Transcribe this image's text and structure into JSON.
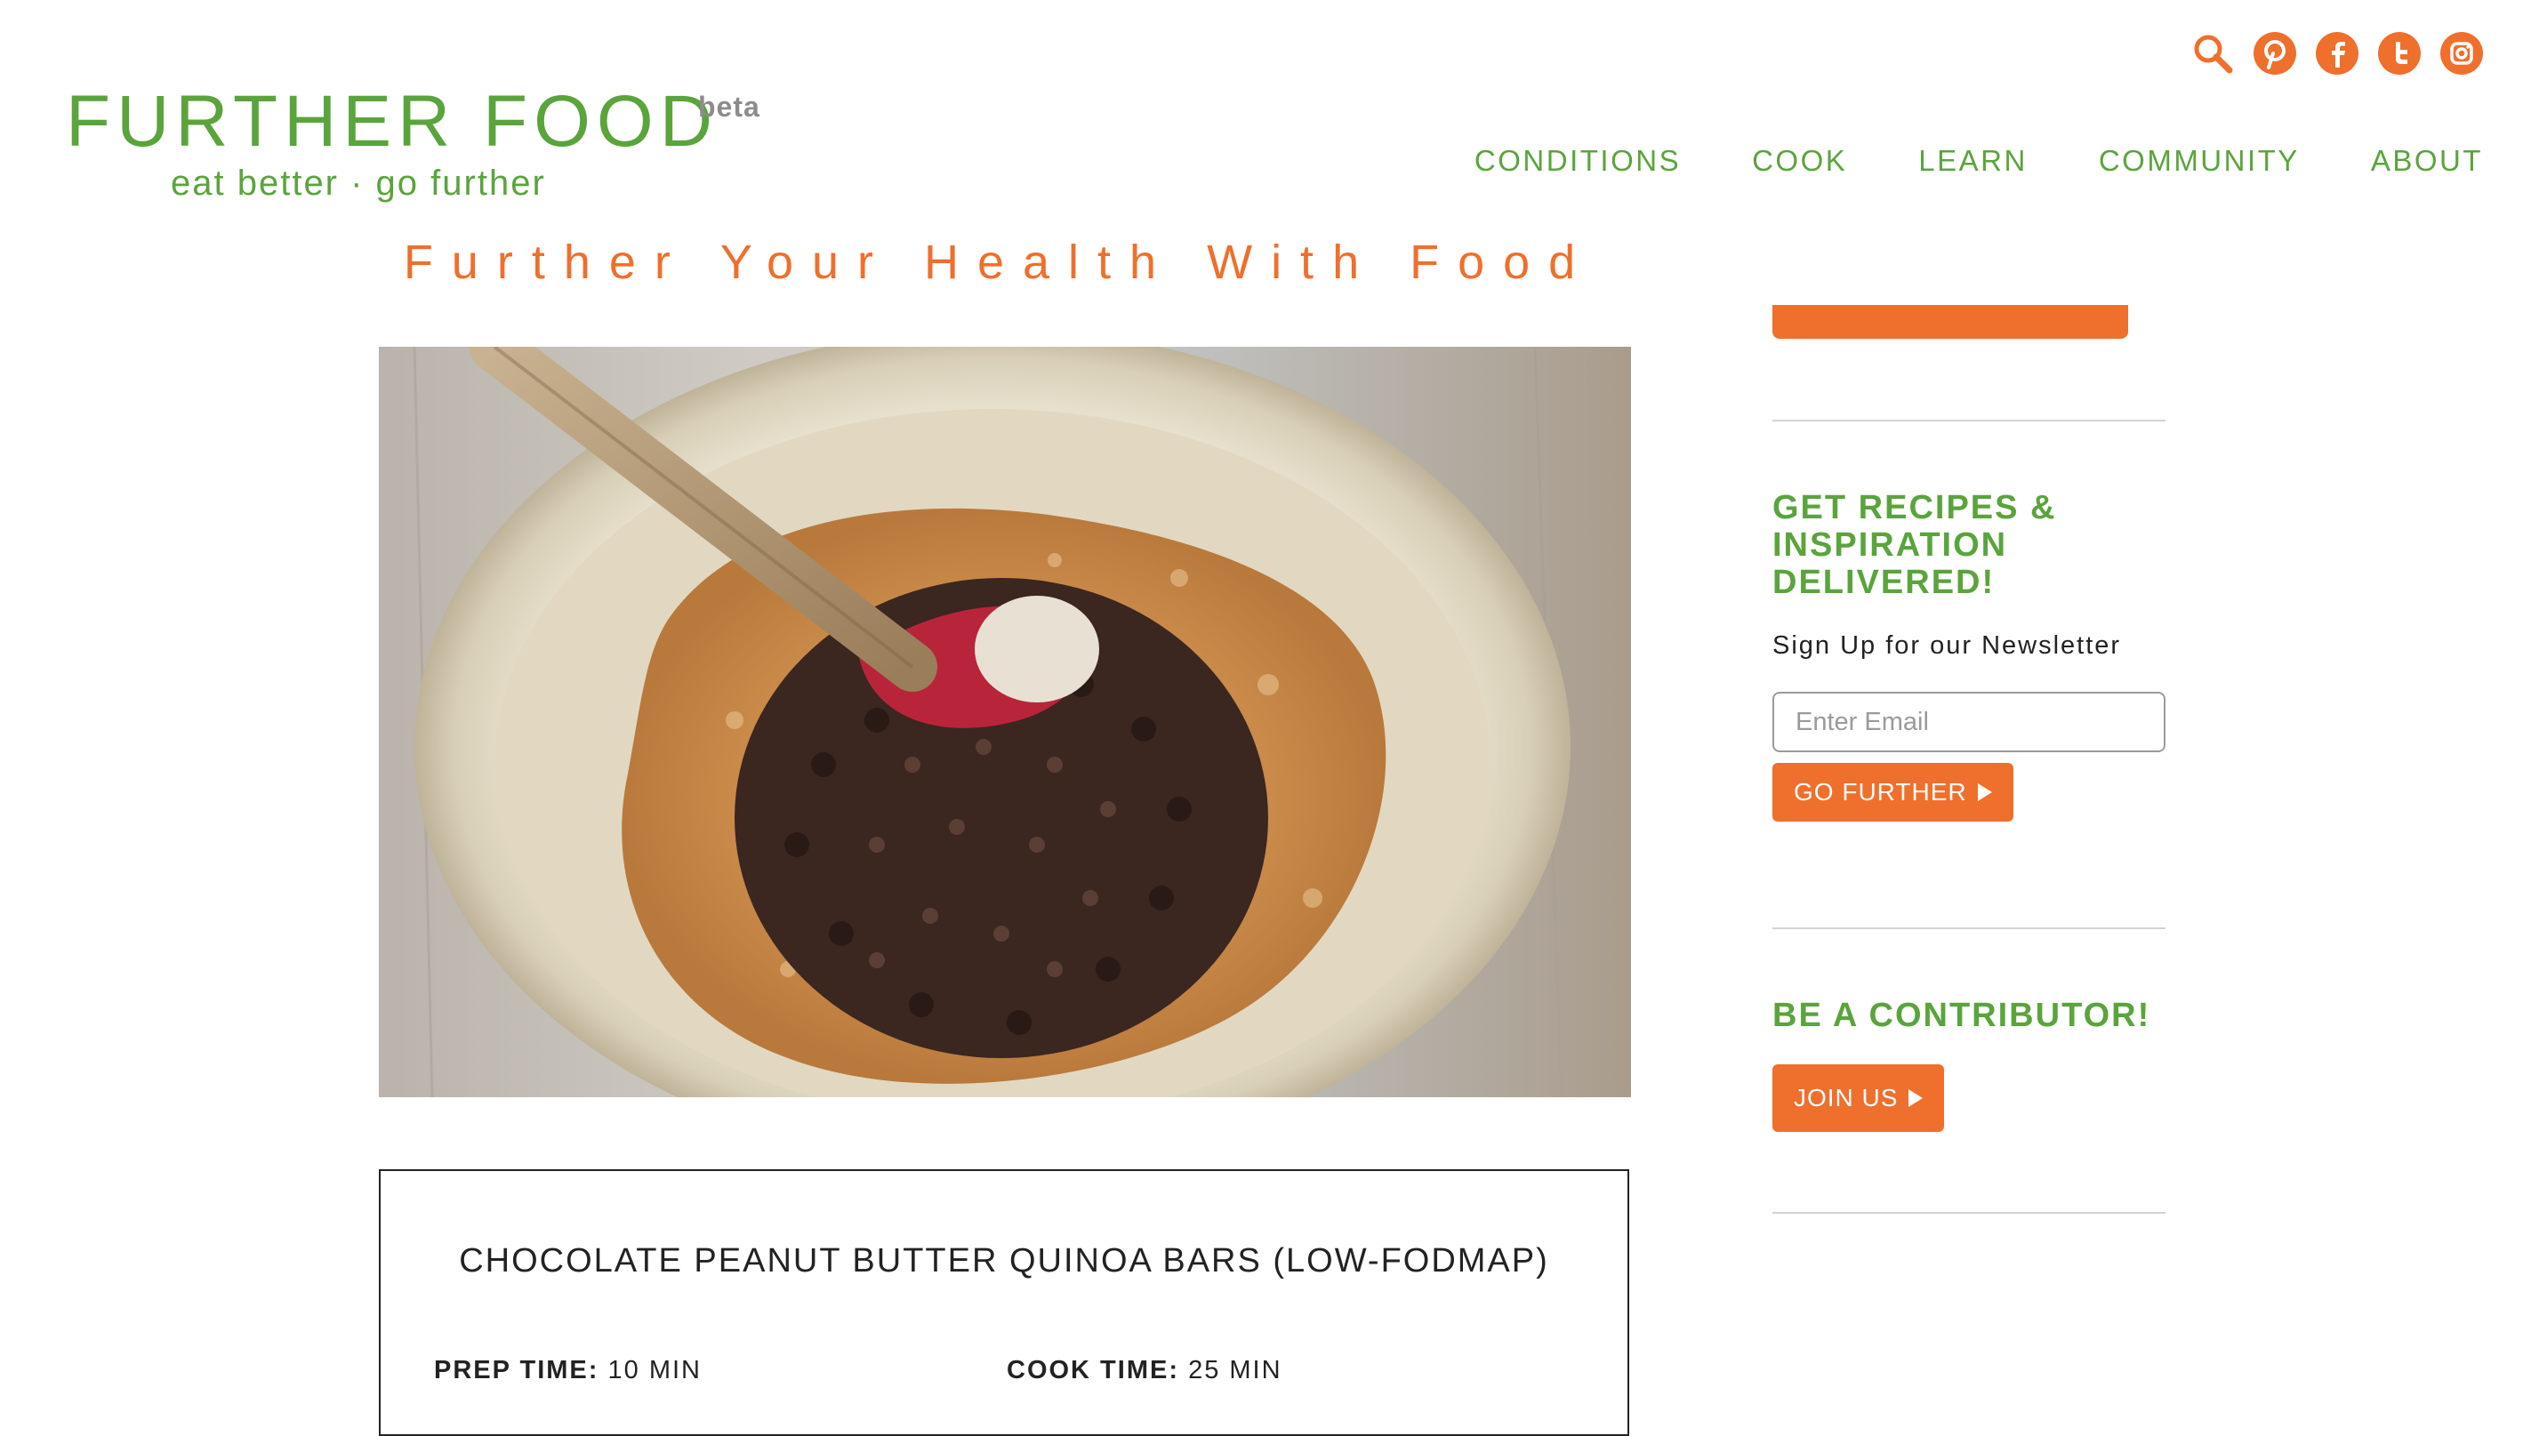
{
  "colors": {
    "brand_green": "#5aa43c",
    "accent_orange": "#ef6f2c",
    "text_dark": "#222222",
    "rule_gray": "#d3d3d3"
  },
  "header": {
    "logo_title": "FURTHER FOOD",
    "logo_badge": "beta",
    "tagline": "eat better · go further",
    "social_icons": [
      "search-icon",
      "pinterest-icon",
      "facebook-icon",
      "twitter-icon",
      "instagram-icon"
    ],
    "nav": [
      {
        "label": "CONDITIONS"
      },
      {
        "label": "COOK"
      },
      {
        "label": "LEARN"
      },
      {
        "label": "COMMUNITY"
      },
      {
        "label": "ABOUT"
      }
    ],
    "headline": "Further Your Health With Food"
  },
  "hero": {
    "image": "chocolate-chip-quinoa-batter-bowl"
  },
  "recipe": {
    "title": "CHOCOLATE PEANUT BUTTER QUINOA BARS (LOW-FODMAP)",
    "prep_label": "PREP TIME:",
    "prep_value": "10 MIN",
    "cook_label": "COOK TIME:",
    "cook_value": "25 MIN"
  },
  "sidebar": {
    "newsletter_heading": "GET RECIPES & INSPIRATION DELIVERED!",
    "newsletter_text": "Sign Up for our Newsletter",
    "email_placeholder": "Enter Email",
    "newsletter_button": "GO FURTHER",
    "contributor_heading": "BE A CONTRIBUTOR!",
    "contributor_button": "JOIN US"
  }
}
